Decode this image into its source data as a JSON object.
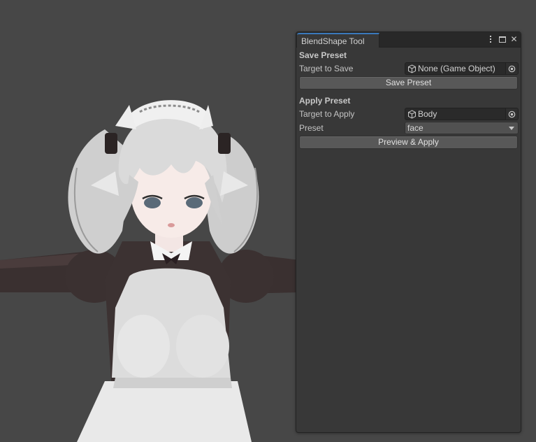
{
  "window": {
    "tab_title": "BlendShape Tool",
    "icons": [
      "kebab-menu-icon",
      "maximize-icon",
      "close-icon"
    ],
    "close_glyph": "✕"
  },
  "save_preset": {
    "header": "Save Preset",
    "target_label": "Target to Save",
    "target_value": "None (Game Object)",
    "button_label": "Save Preset"
  },
  "apply_preset": {
    "header": "Apply Preset",
    "target_label": "Target to Apply",
    "target_value": "Body",
    "preset_label": "Preset",
    "preset_value": "face",
    "button_label": "Preview & Apply"
  },
  "colors": {
    "scene_bg": "#474747",
    "window_bg": "#383838",
    "tab_accent": "#3a79bb",
    "button_bg": "#585858",
    "field_bg": "#2a2a2a"
  }
}
